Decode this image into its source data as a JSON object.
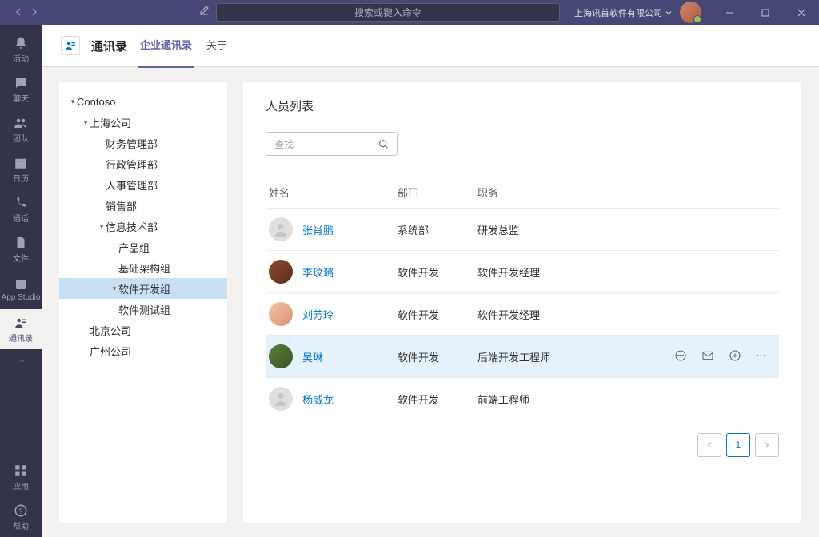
{
  "titlebar": {
    "search_placeholder": "搜索或键入命令",
    "org_name": "上海讯首软件有限公司"
  },
  "rail": {
    "items": [
      {
        "label": "活动",
        "icon": "bell"
      },
      {
        "label": "聊天",
        "icon": "chat"
      },
      {
        "label": "团队",
        "icon": "teams"
      },
      {
        "label": "日历",
        "icon": "calendar"
      },
      {
        "label": "通话",
        "icon": "call"
      },
      {
        "label": "文件",
        "icon": "file"
      },
      {
        "label": "App Studio",
        "icon": "app"
      },
      {
        "label": "通讯录",
        "icon": "contacts"
      }
    ],
    "more": "⋯",
    "bottom": [
      {
        "label": "应用",
        "icon": "apps"
      },
      {
        "label": "帮助",
        "icon": "help"
      }
    ]
  },
  "tabs": {
    "app_title": "通讯录",
    "items": [
      {
        "label": "企业通讯录",
        "active": true
      },
      {
        "label": "关于",
        "active": false
      }
    ]
  },
  "tree": [
    {
      "label": "Contoso",
      "indent": 0,
      "caret": "down"
    },
    {
      "label": "上海公司",
      "indent": 1,
      "caret": "down"
    },
    {
      "label": "财务管理部",
      "indent": 2
    },
    {
      "label": "行政管理部",
      "indent": 2
    },
    {
      "label": "人事管理部",
      "indent": 2
    },
    {
      "label": "销售部",
      "indent": 2
    },
    {
      "label": "信息技术部",
      "indent": 2,
      "caret": "down"
    },
    {
      "label": "产品组",
      "indent": 3
    },
    {
      "label": "基础架构组",
      "indent": 3
    },
    {
      "label": "软件开发组",
      "indent": 3,
      "caret": "down",
      "selected": true
    },
    {
      "label": "软件测试组",
      "indent": 3
    },
    {
      "label": "北京公司",
      "indent": 1
    },
    {
      "label": "广州公司",
      "indent": 1
    }
  ],
  "main": {
    "title": "人员列表",
    "search_placeholder": "查找",
    "columns": {
      "name": "姓名",
      "dept": "部门",
      "role": "职务"
    },
    "rows": [
      {
        "name": "张肖鹏",
        "dept": "系统部",
        "role": "研发总监",
        "avatar": "default"
      },
      {
        "name": "李玟璐",
        "dept": "软件开发",
        "role": "软件开发经理",
        "avatar": "c1"
      },
      {
        "name": "刘芳玲",
        "dept": "软件开发",
        "role": "软件开发经理",
        "avatar": "c2"
      },
      {
        "name": "吴琳",
        "dept": "软件开发",
        "role": "后端开发工程师",
        "avatar": "c3",
        "hover": true
      },
      {
        "name": "杨威龙",
        "dept": "软件开发",
        "role": "前端工程师",
        "avatar": "default"
      }
    ],
    "page": "1"
  }
}
